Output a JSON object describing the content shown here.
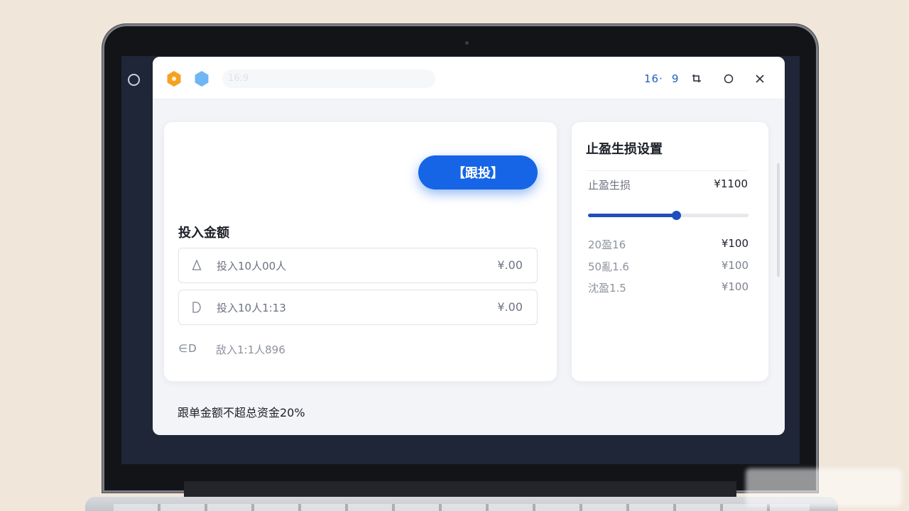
{
  "titlebar": {
    "address_text": "16:9",
    "ratio_left": "16·",
    "ratio_right": "9"
  },
  "follow": {
    "button_label": "【跟投】"
  },
  "investment": {
    "title": "投入金额",
    "rows": [
      {
        "icon": "triangle-icon",
        "label": "投入10人00人",
        "value": "¥.00"
      },
      {
        "icon": "d-shape-icon",
        "label": "投入10人1:13",
        "value": "¥.00"
      }
    ],
    "plain_row": {
      "icon_text": "∈D",
      "label": "敌入1:1人896"
    }
  },
  "stop_settings": {
    "title": "止盈生损设置",
    "main_label": "止盈生损",
    "main_value": "¥1100",
    "slider_level": 0.55,
    "items": [
      {
        "label": "20盈16",
        "value": "¥100"
      },
      {
        "label": "50亂1.6",
        "value": "¥100"
      },
      {
        "label": "沈盈1.5",
        "value": "¥100"
      }
    ]
  },
  "footer_note": "跟单金额不超总资金20%",
  "colors": {
    "accent": "#1565e6",
    "slider": "#1e4fbf",
    "brand_orange": "#f4a225",
    "brand_blue": "#6fb6f2"
  }
}
